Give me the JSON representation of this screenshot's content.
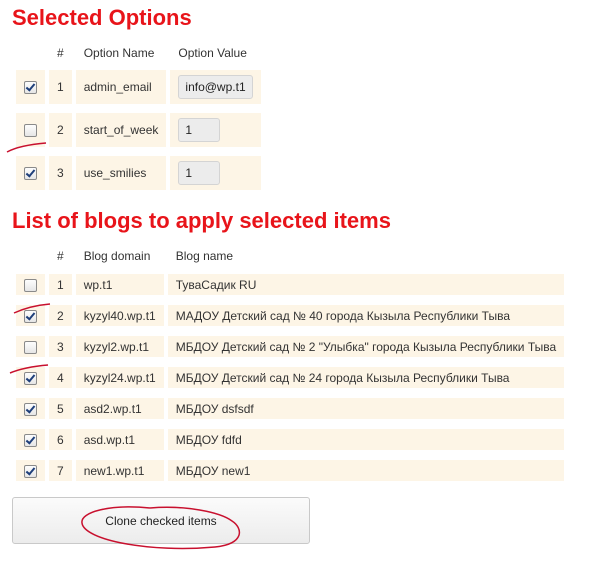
{
  "selected_options": {
    "title": "Selected Options",
    "headers": [
      "#",
      "Option Name",
      "Option Value"
    ],
    "rows": [
      {
        "checked": true,
        "num": "1",
        "name": "admin_email",
        "value": "info@wp.t1"
      },
      {
        "checked": false,
        "num": "2",
        "name": "start_of_week",
        "value": "1"
      },
      {
        "checked": true,
        "num": "3",
        "name": "use_smilies",
        "value": "1"
      }
    ]
  },
  "blogs": {
    "title": "List of blogs to apply selected items",
    "headers": [
      "#",
      "Blog domain",
      "Blog name"
    ],
    "rows": [
      {
        "checked": false,
        "num": "1",
        "domain": "wp.t1",
        "name": "ТуваСадик RU"
      },
      {
        "checked": true,
        "num": "2",
        "domain": "kyzyl40.wp.t1",
        "name": "МАДОУ Детский сад № 40 города Кызыла Республики Тыва"
      },
      {
        "checked": false,
        "num": "3",
        "domain": "kyzyl2.wp.t1",
        "name": "МБДОУ Детский сад № 2 \"Улыбка\" города Кызыла Республики Тыва"
      },
      {
        "checked": true,
        "num": "4",
        "domain": "kyzyl24.wp.t1",
        "name": "МБДОУ Детский сад № 24 города Кызыла Республики Тыва"
      },
      {
        "checked": true,
        "num": "5",
        "domain": "asd2.wp.t1",
        "name": "МБДОУ dsfsdf"
      },
      {
        "checked": true,
        "num": "6",
        "domain": "asd.wp.t1",
        "name": "МБДОУ fdfd"
      },
      {
        "checked": true,
        "num": "7",
        "domain": "new1.wp.t1",
        "name": "МБДОУ new1"
      }
    ]
  },
  "clone_button": {
    "label": "Clone checked items"
  },
  "colors": {
    "heading": "#e8141a",
    "row_bg": "#fdf5e6",
    "annotation": "#c8102e"
  }
}
